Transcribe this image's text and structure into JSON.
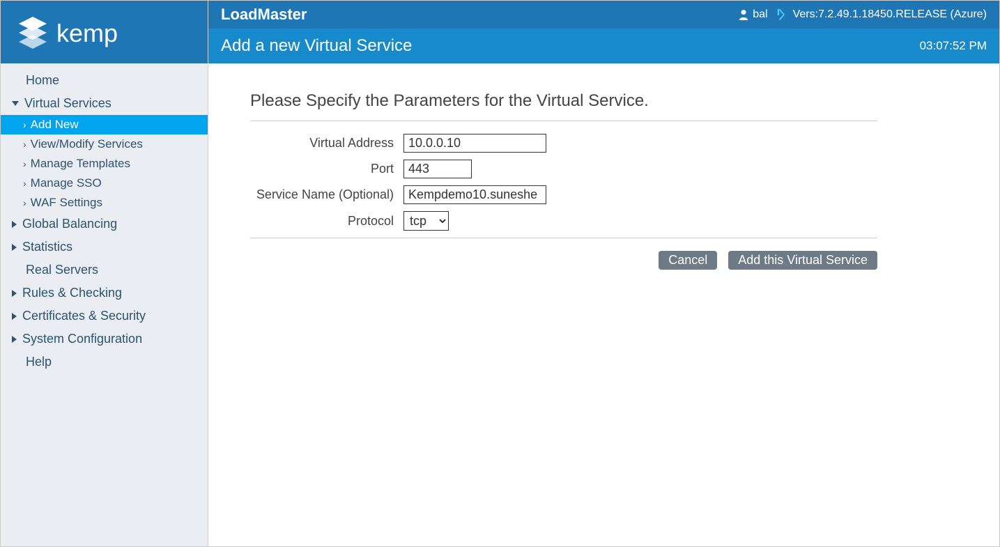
{
  "header": {
    "app_title": "LoadMaster",
    "page_title": "Add a new Virtual Service",
    "username": "bal",
    "version": "Vers:7.2.49.1.18450.RELEASE (Azure)",
    "clock": "03:07:52 PM"
  },
  "sidebar": {
    "home": "Home",
    "virtual_services": {
      "label": "Virtual Services",
      "add_new": "Add New",
      "view_modify": "View/Modify Services",
      "manage_templates": "Manage Templates",
      "manage_sso": "Manage SSO",
      "waf_settings": "WAF Settings"
    },
    "global_balancing": "Global Balancing",
    "statistics": "Statistics",
    "real_servers": "Real Servers",
    "rules_checking": "Rules & Checking",
    "certificates_security": "Certificates & Security",
    "system_configuration": "System Configuration",
    "help": "Help"
  },
  "form": {
    "title": "Please Specify the Parameters for the Virtual Service.",
    "labels": {
      "virtual_address": "Virtual Address",
      "port": "Port",
      "service_name": "Service Name (Optional)",
      "protocol": "Protocol"
    },
    "values": {
      "virtual_address": "10.0.0.10",
      "port": "443",
      "service_name": "Kempdemo10.suneshe",
      "protocol": "tcp"
    },
    "buttons": {
      "cancel": "Cancel",
      "add": "Add this Virtual Service"
    }
  }
}
